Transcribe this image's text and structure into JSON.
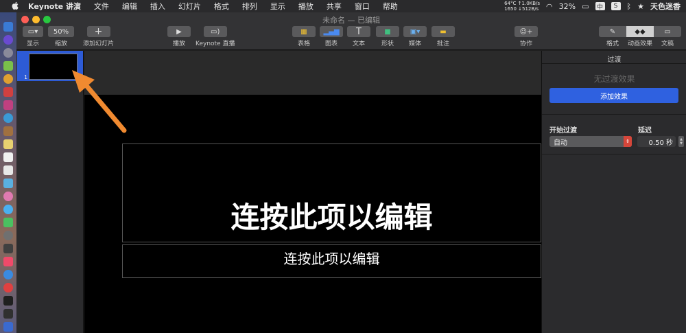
{
  "menubar": {
    "apple_icon": "apple-icon",
    "items": [
      "Keynote 讲演",
      "文件",
      "编辑",
      "插入",
      "幻灯片",
      "格式",
      "排列",
      "显示",
      "播放",
      "共享",
      "窗口",
      "帮助"
    ],
    "netstat_top": "64°C ↑1.0KB/s",
    "netstat_bottom": "1650 ↓512B/s",
    "battery": "32%",
    "input_method": "中",
    "user": "天色迷香"
  },
  "window": {
    "title": "未命名 — 已编辑"
  },
  "toolbar": {
    "view_label": "显示",
    "zoom_value": "50%",
    "zoom_label": "缩放",
    "add_slide_label": "添加幻灯片",
    "play_label": "播放",
    "keynote_live_label": "Keynote 直播",
    "table_label": "表格",
    "chart_label": "图表",
    "text_label": "文本",
    "shape_label": "形状",
    "media_label": "媒体",
    "comment_label": "批注",
    "collaborate_label": "协作",
    "format_label": "格式",
    "animate_label": "动画效果",
    "document_label": "文稿"
  },
  "navigator": {
    "slide_number": "1"
  },
  "slide": {
    "title_placeholder": "连按此项以编辑",
    "body_placeholder": "连按此项以编辑"
  },
  "inspector": {
    "heading": "过渡",
    "no_transition": "无过渡效果",
    "add_effect_label": "添加效果",
    "start_transition_label": "开始过渡",
    "start_transition_value": "自动",
    "delay_label": "延迟",
    "delay_value": "0.50 秒"
  },
  "colors": {
    "accent_blue": "#2f61e0",
    "arrow_orange": "#f08a30",
    "select_red": "#d6463a"
  }
}
